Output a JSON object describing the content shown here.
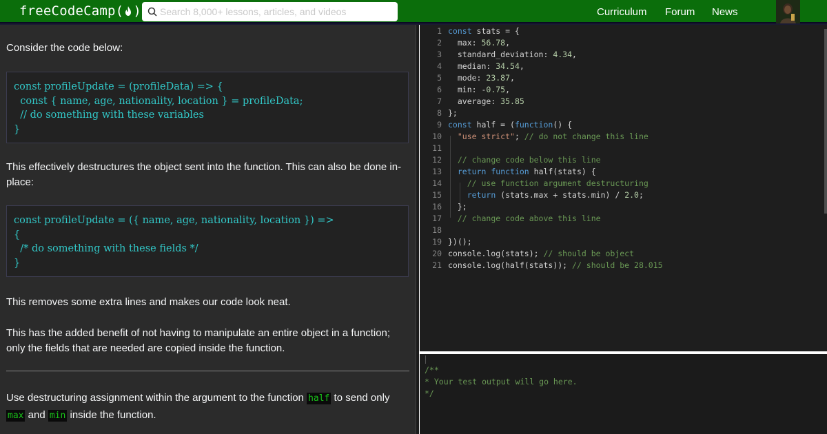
{
  "navbar": {
    "logo_left": "freeCodeCamp(",
    "logo_right": ")",
    "search_placeholder": "Search 8,000+ lessons, articles, and videos",
    "links": [
      "Curriculum",
      "Forum",
      "News"
    ]
  },
  "lesson": {
    "p1": "Consider the code below:",
    "code1": [
      "const profileUpdate = (profileData) => {",
      "  const { name, age, nationality, location } = profileData;",
      "  // do something with these variables",
      "}"
    ],
    "p2": "This effectively destructures the object sent into the function. This can also be done in-place:",
    "code2": [
      "const profileUpdate = ({ name, age, nationality, location }) =>",
      "{",
      "  /* do something with these fields */",
      "}"
    ],
    "p3": "This removes some extra lines and makes our code look neat.",
    "p4": "This has the added benefit of not having to manipulate an entire object in a function; only the fields that are needed are copied inside the function.",
    "task_pre": "Use destructuring assignment within the argument to the function ",
    "task_code_half": "half",
    "task_mid": " to send only",
    "task_code_max": "max",
    "task_and": " and ",
    "task_code_min": "min",
    "task_post": " inside the function."
  },
  "editor": {
    "line_numbers": [
      "1",
      "2",
      "3",
      "4",
      "5",
      "6",
      "7",
      "8",
      "9",
      "10",
      "11",
      "12",
      "13",
      "14",
      "15",
      "16",
      "17",
      "18",
      "19",
      "20",
      "21"
    ],
    "l1": [
      "const",
      " stats = {"
    ],
    "l2": [
      "  max: ",
      "56.78",
      ","
    ],
    "l3": [
      "  standard_deviation: ",
      "4.34",
      ","
    ],
    "l4": [
      "  median: ",
      "34.54",
      ","
    ],
    "l5": [
      "  mode: ",
      "23.87",
      ","
    ],
    "l6": [
      "  min: -",
      "0.75",
      ","
    ],
    "l7": [
      "  average: ",
      "35.85"
    ],
    "l8": [
      "};"
    ],
    "l9": [
      "const",
      " half = (",
      "function",
      "() {"
    ],
    "l10": [
      "  ",
      "\"use strict\"",
      "; ",
      "// do not change this line"
    ],
    "l11": [
      ""
    ],
    "l12": [
      "  ",
      "// change code below this line"
    ],
    "l13": [
      "  ",
      "return",
      " ",
      "function",
      " half(stats) {"
    ],
    "l14": [
      "    ",
      "// use function argument destructuring"
    ],
    "l15": [
      "    ",
      "return",
      " (stats.max + stats.min) / ",
      "2.0",
      ";"
    ],
    "l16": [
      "  };"
    ],
    "l17": [
      "  ",
      "// change code above this line"
    ],
    "l18": [
      ""
    ],
    "l19": [
      "})();"
    ],
    "l20": [
      "console.log(stats); ",
      "// should be object"
    ],
    "l21": [
      "console.log(half(stats)); ",
      "// should be 28.015"
    ]
  },
  "console": {
    "lines": [
      "/**",
      "* Your test output will go here.",
      "*/"
    ]
  },
  "colors": {
    "navbar": "#0b6e0b",
    "inline_code": "#19c419",
    "code_block_text": "#32c8c8"
  },
  "icons": [
    "fire-icon",
    "search-icon",
    "avatar"
  ]
}
